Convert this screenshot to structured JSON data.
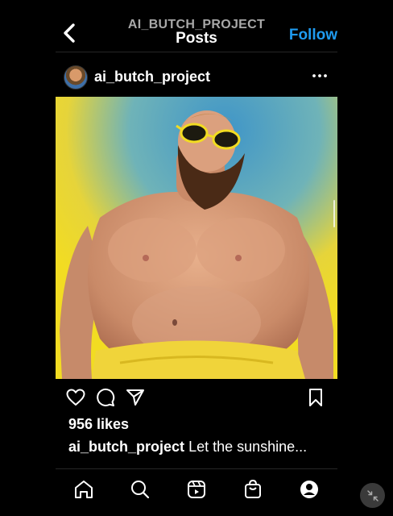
{
  "header": {
    "username": "AI_BUTCH_PROJECT",
    "title": "Posts",
    "follow_label": "Follow"
  },
  "post": {
    "username": "ai_butch_project",
    "likes": "956 likes",
    "caption_user": "ai_butch_project",
    "caption_text": "Let the sunshine..."
  },
  "icons": {
    "back": "chevron-left-icon",
    "more": "more-horizontal-icon",
    "like": "heart-icon",
    "comment": "comment-icon",
    "share": "send-icon",
    "save": "bookmark-icon",
    "nav": [
      "home-icon",
      "search-icon",
      "reels-icon",
      "shop-icon",
      "profile-icon"
    ]
  },
  "colors": {
    "accent": "#1f9bf0",
    "background": "#000000",
    "muted": "#a8a8a8"
  }
}
